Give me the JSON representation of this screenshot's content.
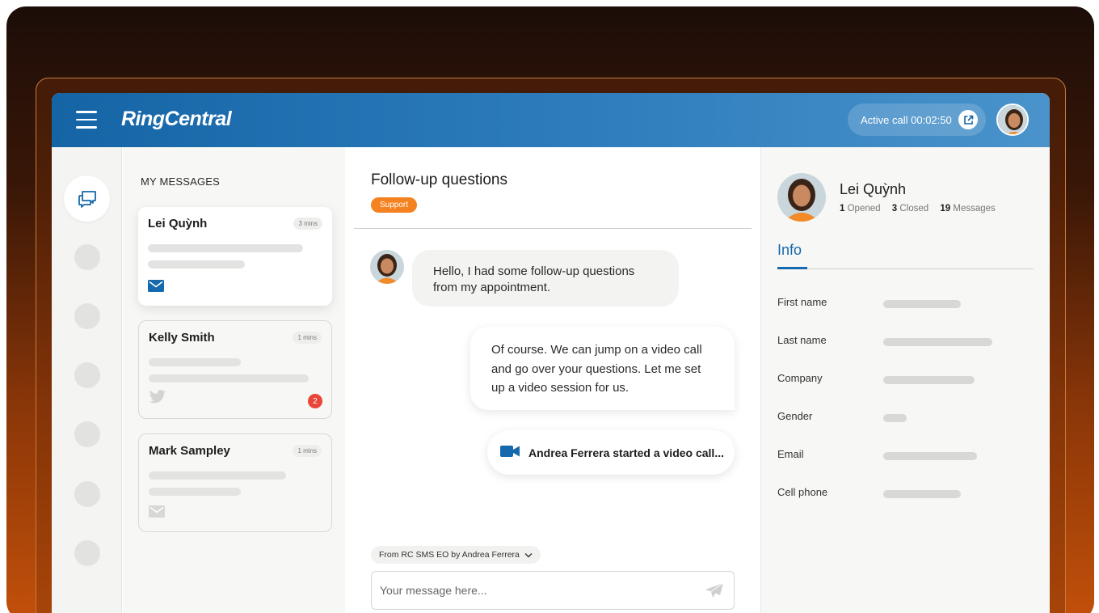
{
  "header": {
    "logo_text": "RingCentral",
    "active_call_label": "Active call 00:02:50",
    "menu_icon": "hamburger-icon",
    "popout_icon": "popout-icon",
    "brand_color": "#1565a6"
  },
  "sidebar": {
    "active_icon": "messages-icon",
    "items": [
      "messages",
      "nav-2",
      "nav-3",
      "nav-4",
      "nav-5",
      "nav-6",
      "nav-7"
    ]
  },
  "messages": {
    "title": "MY MESSAGES",
    "items": [
      {
        "name": "Lei Quỳnh",
        "time": "3 mins",
        "channel_icon": "email-icon",
        "selected": true
      },
      {
        "name": "Kelly Smith",
        "time": "1 mins",
        "channel_icon": "twitter-icon",
        "unread": "2"
      },
      {
        "name": "Mark Sampley",
        "time": "1 mins",
        "channel_icon": "email-icon"
      }
    ]
  },
  "conversation": {
    "title": "Follow-up questions",
    "tag": "Support",
    "tag_color": "#f58220",
    "messages": [
      {
        "direction": "in",
        "text": "Hello, I had some follow-up questions from my appointment."
      },
      {
        "direction": "out",
        "text": "Of course. We can jump on a video call and go over your questions. Let me set up a video session for us."
      }
    ],
    "event": {
      "icon": "video-camera-icon",
      "text": "Andrea Ferrera started a video call..."
    },
    "from_label": "From RC SMS EO by Andrea Ferrera",
    "composer_placeholder": "Your message here...",
    "send_icon": "send-icon"
  },
  "contact": {
    "name": "Lei Quỳnh",
    "opened_count": "1",
    "opened_label": "Opened",
    "closed_count": "3",
    "closed_label": "Closed",
    "messages_count": "19",
    "messages_label": "Messages",
    "tab": "Info",
    "fields": [
      "First name",
      "Last name",
      "Company",
      "Gender",
      "Email",
      "Cell phone"
    ]
  }
}
